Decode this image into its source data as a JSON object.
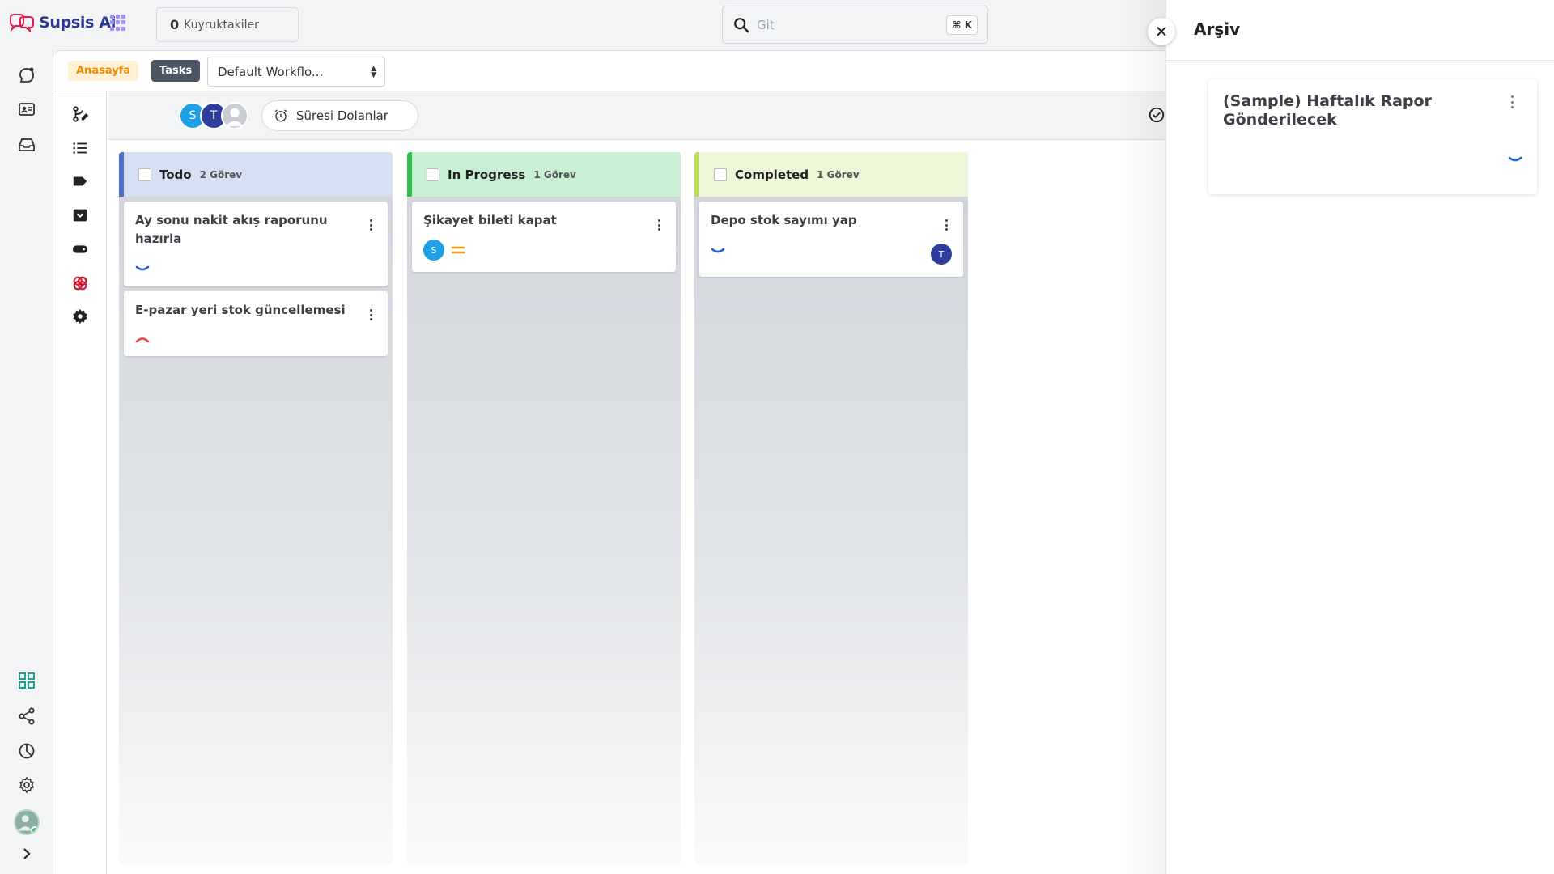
{
  "app": {
    "name": "Supsis Ai"
  },
  "topbar": {
    "queue_count": "0",
    "queue_label": "Kuyruktakiler",
    "search_placeholder": "Git",
    "search_shortcut": "⌘ K"
  },
  "breadcrumb": {
    "home": "Anasayfa",
    "current": "Tasks",
    "workflow": "Default Workflo..."
  },
  "filters": {
    "avatars": [
      {
        "initial": "S",
        "color": "#1ea0e6"
      },
      {
        "initial": "T",
        "color": "#2f3d9c"
      },
      {
        "initial": "",
        "color": "#c9ccd1"
      }
    ],
    "deadline_label": "Süresi Dolanlar"
  },
  "columns": [
    {
      "title": "Todo",
      "count": "2 Görev",
      "header_bg": "#d7dff2",
      "accent": "#4a6fd1",
      "cards": [
        {
          "title": "Ay sonu nakit akış raporunu hazırla",
          "priority": "low"
        },
        {
          "title": "E-pazar yeri stok güncellemesi",
          "priority": "high"
        }
      ]
    },
    {
      "title": "In Progress",
      "count": "1 Görev",
      "header_bg": "#c9f0d2",
      "accent": "#2cc04a",
      "cards": [
        {
          "title": "Şikayet bileti kapat",
          "priority": "medium",
          "assignee": "S"
        }
      ]
    },
    {
      "title": "Completed",
      "count": "1 Görev",
      "header_bg": "#eef6d8",
      "accent": "#b8dc5b",
      "cards": [
        {
          "title": "Depo stok sayımı yap",
          "priority": "low",
          "assignee": "T"
        }
      ]
    }
  ],
  "archive": {
    "title": "Arşiv",
    "items": [
      {
        "title": "(Sample) Haftalık Rapor Gönderilecek",
        "priority": "low"
      }
    ]
  },
  "colors": {
    "priority_low": "#1f5fe0",
    "priority_medium": "#f59e0b",
    "priority_high": "#ef4444"
  }
}
